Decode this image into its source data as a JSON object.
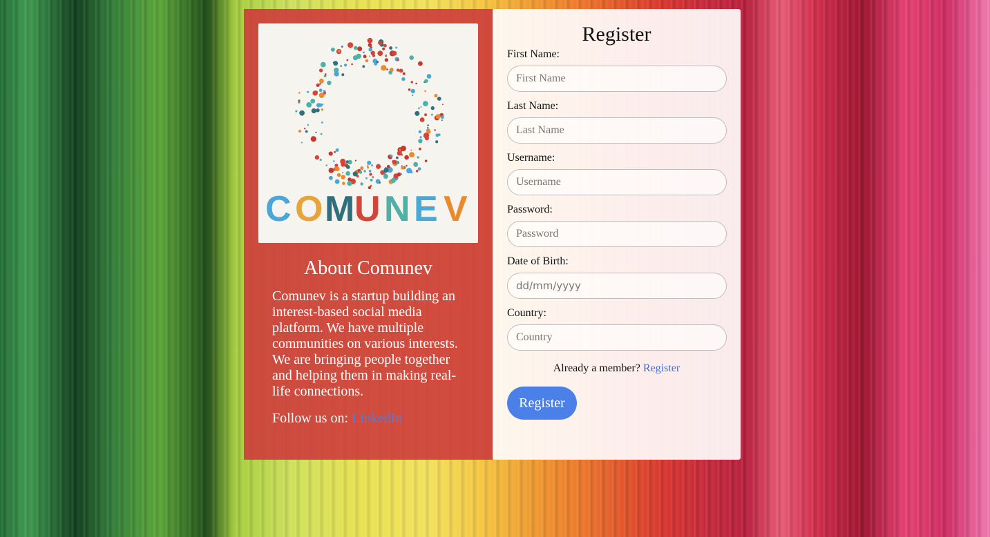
{
  "about": {
    "logo_text": "COMUNEV",
    "logo_colors": [
      "#4ba7d8",
      "#e7a43c",
      "#2f6f7e",
      "#d2453a",
      "#4fb0a6",
      "#4aa8d6",
      "#e98a2e"
    ],
    "title": "About Comunev",
    "description": "Comunev is a startup building an interest-based social media platform. We have multiple communities on various interests. We are bringing people together and helping them in making real-life connections.",
    "follow_prefix": "Follow us on: ",
    "follow_link": "LinkedIn"
  },
  "form": {
    "title": "Register",
    "fields": [
      {
        "label": "First Name:",
        "placeholder": "First Name"
      },
      {
        "label": "Last Name:",
        "placeholder": "Last Name"
      },
      {
        "label": "Username:",
        "placeholder": "Username"
      },
      {
        "label": "Password:",
        "placeholder": "Password"
      },
      {
        "label": "Date of Birth:",
        "placeholder": "dd/mm/yyyy"
      },
      {
        "label": "Country:",
        "placeholder": "Country"
      }
    ],
    "member_text": "Already a member?",
    "member_link": "Register",
    "submit_label": "Register"
  },
  "colors": {
    "panel_red": "#cd3c3c",
    "link_blue": "#3b6fe0",
    "button_blue": "#4a80e8"
  }
}
